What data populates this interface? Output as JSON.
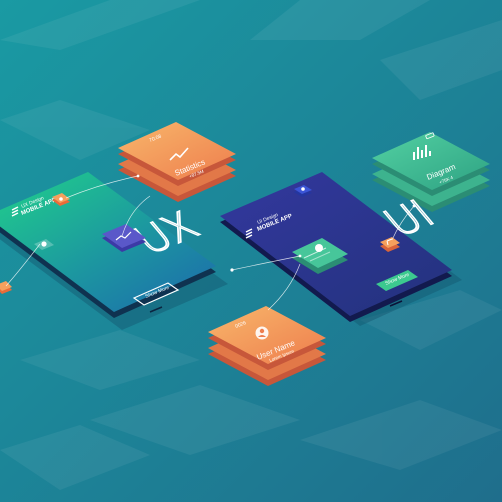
{
  "scene": {
    "background": "#1f7e8d",
    "ux_phone": {
      "title_small": "UX Design",
      "title_main": "MOBILE APP",
      "big_label": "UX",
      "button_label": "Show More",
      "gradient_colors": [
        "#1fcf86",
        "#1d6fae"
      ]
    },
    "ui_phone": {
      "title_small": "UI Design",
      "title_main": "MOBILE APP",
      "big_label": "UI",
      "button_label": "Show More",
      "gradient_colors": [
        "#2f3aa8",
        "#1e2f8c"
      ]
    },
    "cards": {
      "statistics": {
        "title": "Statistics",
        "subtitle": "+87.5M",
        "top_text": "70:08",
        "color": "#f59b5a"
      },
      "diagram": {
        "title": "Diagram",
        "subtitle": "+75K 4",
        "color": "#38b38a"
      },
      "user_name": {
        "title": "User Name",
        "subtitle": "Lorem Ipsum",
        "top_text": "0026",
        "color": "#f39c5c"
      }
    },
    "icons": [
      "hamburger-menu-icon",
      "user-icon",
      "bar-chart-icon",
      "line-chart-icon",
      "battery-icon",
      "expand-icon"
    ]
  }
}
